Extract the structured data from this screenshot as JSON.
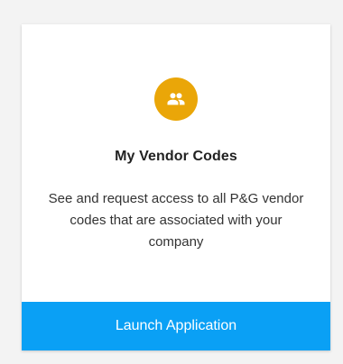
{
  "card": {
    "icon": "people-group-icon",
    "title": "My Vendor Codes",
    "description": "See and request access to all P&G vendor codes that are associated with your company",
    "launch_label": "Launch Application"
  },
  "colors": {
    "accent": "#eaa608",
    "button": "#0aa0f5",
    "background": "#f3f3f3"
  }
}
